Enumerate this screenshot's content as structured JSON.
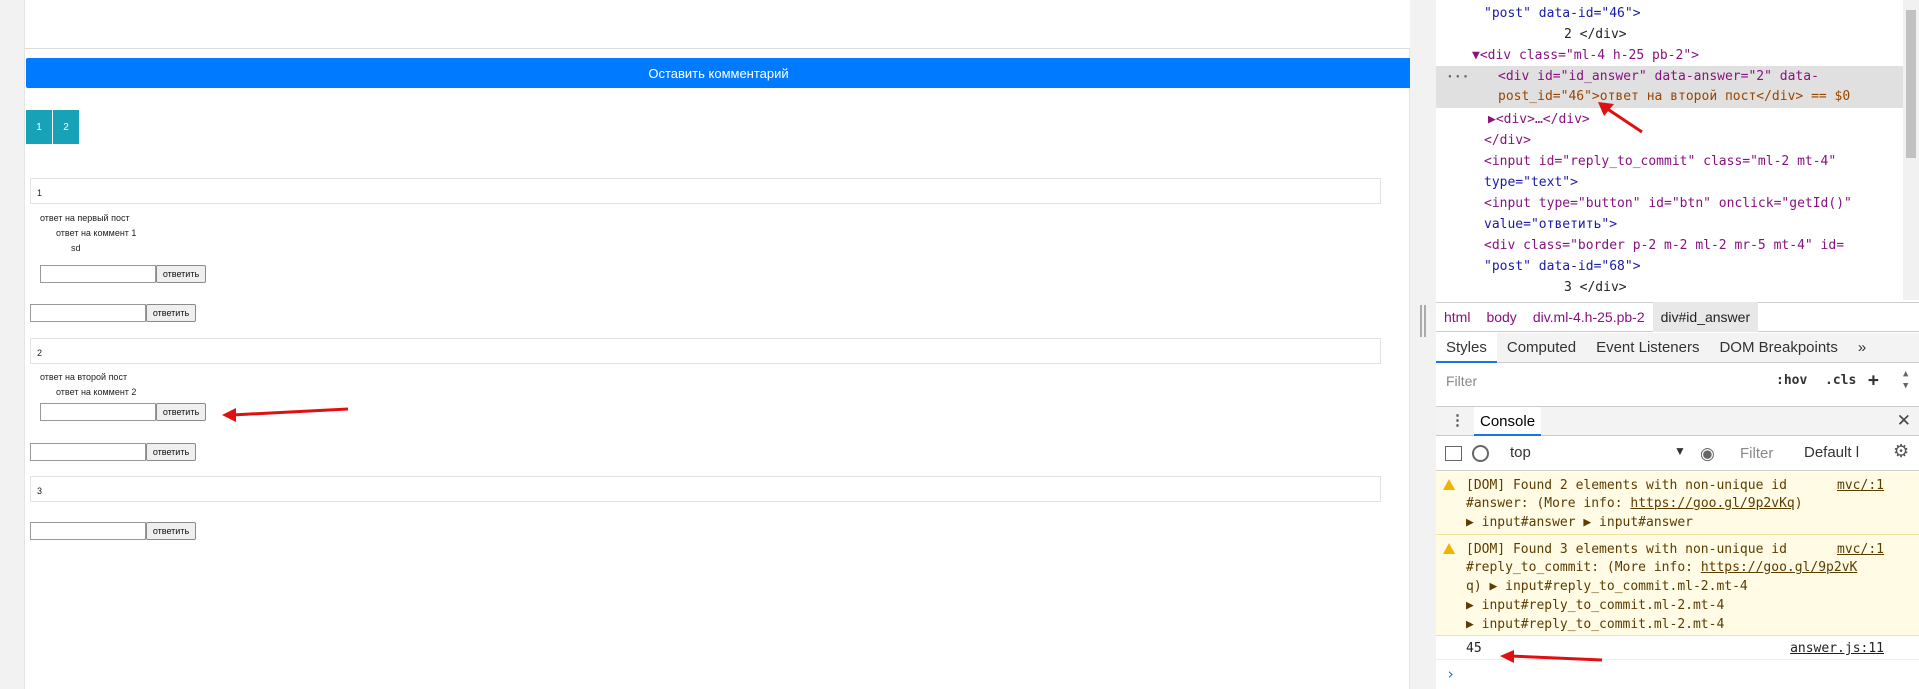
{
  "page": {
    "leave_comment_label": "Оставить комментарий",
    "pages": [
      "1",
      "2"
    ],
    "posts": [
      {
        "num": "1",
        "answers": [
          "ответ на первый пост",
          "ответ на коммент 1",
          "sd"
        ]
      },
      {
        "num": "2",
        "answers": [
          "ответ на второй пост",
          "ответ на коммент 2"
        ]
      },
      {
        "num": "3",
        "answers": []
      }
    ],
    "reply_label": "ответить"
  },
  "devtools": {
    "elements_lines": [
      {
        "text": "\"post\" data-id=\"46\">"
      },
      {
        "text": "2       </div>"
      },
      {
        "text": "▼<div class=\"ml-4 h-25  pb-2\">"
      },
      {
        "text": "<div id=\"id_answer\" data-answer=\"2\" data-"
      },
      {
        "text": "post_id=\"46\">ответ на второй пост</div> == $0"
      },
      {
        "text": "▶<div>…</div>"
      },
      {
        "text": "</div>"
      },
      {
        "text": "<input id=\"reply_to_commit\" class=\"ml-2 mt-4\""
      },
      {
        "text": "type=\"text\">"
      },
      {
        "text": "<input type=\"button\" id=\"btn\" onclick=\"getId()\""
      },
      {
        "text": "value=\"ответить\">"
      },
      {
        "text": "<div class=\"border p-2 m-2 ml-2 mr-5 mt-4\" id="
      },
      {
        "text": "\"post\" data-id=\"68\">"
      },
      {
        "text": "3       </div>"
      }
    ],
    "breadcrumbs": [
      "html",
      "body",
      "div.ml-4.h-25.pb-2",
      "div#id_answer"
    ],
    "tabs": [
      "Styles",
      "Computed",
      "Event Listeners",
      "DOM Breakpoints",
      "»"
    ],
    "filter_placeholder": "Filter",
    "hov": ":hov",
    "cls": ".cls",
    "console_title": "Console",
    "context": "top",
    "console_filter": "Filter",
    "levels": "Default l",
    "messages": [
      {
        "l1": "[DOM] Found 2 elements with non-unique id",
        "l2": "#answer: (More info: ",
        "link": "https://goo.gl/9p2vKq",
        "l2end": ")",
        "l3": "▶ input#answer ▶ input#answer",
        "src": "mvc/:1"
      },
      {
        "l1": "[DOM] Found 3 elements with non-unique id",
        "l2": "#reply_to_commit: (More info: ",
        "link": "https://goo.gl/9p2vK",
        "l3": "q) ▶ input#reply_to_commit.ml-2.mt-4",
        "l4": "▶ input#reply_to_commit.ml-2.mt-4",
        "l5": "▶ input#reply_to_commit.ml-2.mt-4",
        "src": "mvc/:1"
      }
    ],
    "log_value": "45",
    "log_src": "answer.js:11",
    "prompt": "›"
  },
  "colors": {
    "accent": "#007bff",
    "pager": "#17a2b8",
    "arrow": "#e01010"
  }
}
